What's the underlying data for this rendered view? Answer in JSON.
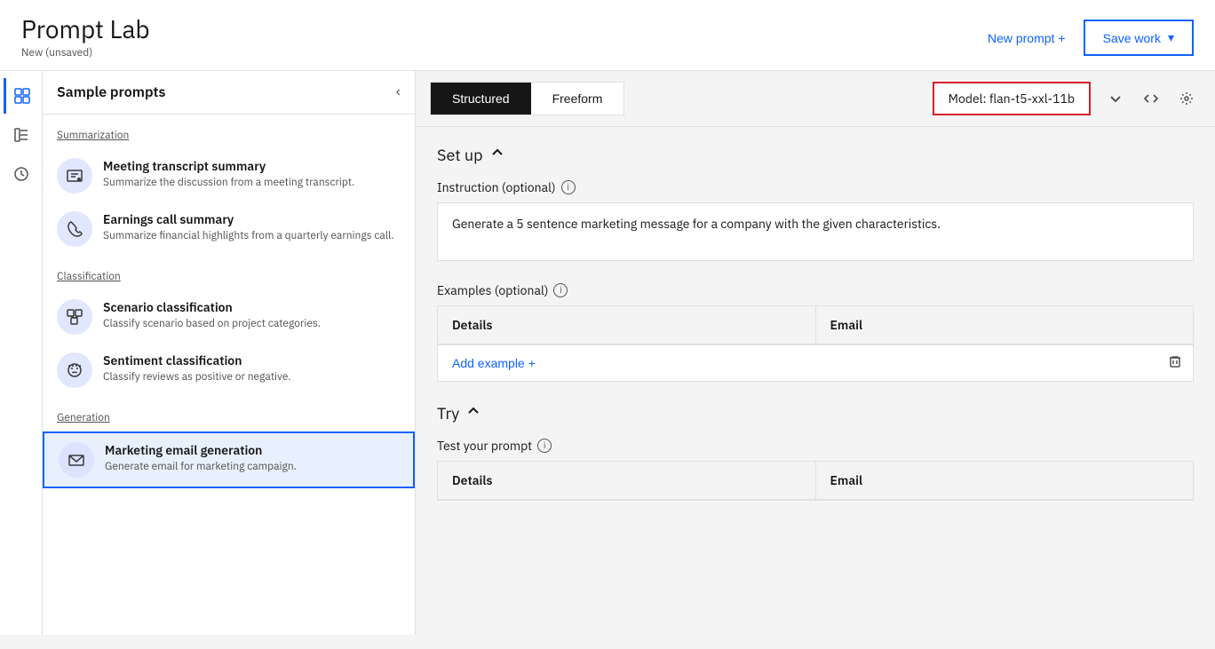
{
  "header": {
    "title": "Prompt Lab",
    "subtitle": "New (unsaved)",
    "new_prompt_label": "New prompt",
    "new_prompt_icon": "+",
    "save_work_label": "Save work",
    "save_work_icon": "▾"
  },
  "sidebar": {
    "icons": [
      {
        "id": "grid-icon",
        "label": "Grid",
        "active": true
      },
      {
        "id": "bracket-icon",
        "label": "Bracket",
        "active": false
      },
      {
        "id": "clock-icon",
        "label": "History",
        "active": false
      }
    ]
  },
  "sample_prompts": {
    "panel_title": "Sample prompts",
    "close_icon": "‹",
    "categories": [
      {
        "id": "summarization",
        "label": "Summarization",
        "items": [
          {
            "id": "meeting-transcript",
            "name": "Meeting transcript summary",
            "desc": "Summarize the discussion from a meeting transcript.",
            "icon": "meeting"
          },
          {
            "id": "earnings-call",
            "name": "Earnings call summary",
            "desc": "Summarize financial highlights from a quarterly earnings call.",
            "icon": "phone"
          }
        ]
      },
      {
        "id": "classification",
        "label": "Classification",
        "items": [
          {
            "id": "scenario-classification",
            "name": "Scenario classification",
            "desc": "Classify scenario based on project categories.",
            "icon": "scenario"
          },
          {
            "id": "sentiment-classification",
            "name": "Sentiment classification",
            "desc": "Classify reviews as positive or negative.",
            "icon": "sentiment"
          }
        ]
      },
      {
        "id": "generation",
        "label": "Generation",
        "items": [
          {
            "id": "marketing-email",
            "name": "Marketing email generation",
            "desc": "Generate email for marketing campaign.",
            "icon": "email",
            "selected": true
          }
        ]
      }
    ]
  },
  "content": {
    "tabs": [
      {
        "id": "structured",
        "label": "Structured",
        "active": true
      },
      {
        "id": "freeform",
        "label": "Freeform",
        "active": false
      }
    ],
    "model_label": "Model: flan-t5-xxl-11b",
    "setup_section": {
      "title": "Set up",
      "instruction_label": "Instruction (optional)",
      "instruction_value": "Generate a 5 sentence marketing message for a company with the given characteristics.",
      "examples_label": "Examples (optional)",
      "table_columns": [
        "Details",
        "Email"
      ],
      "add_example_label": "Add example",
      "add_example_icon": "+"
    },
    "try_section": {
      "title": "Try",
      "test_prompt_label": "Test your prompt",
      "table_columns": [
        "Details",
        "Email"
      ]
    }
  }
}
